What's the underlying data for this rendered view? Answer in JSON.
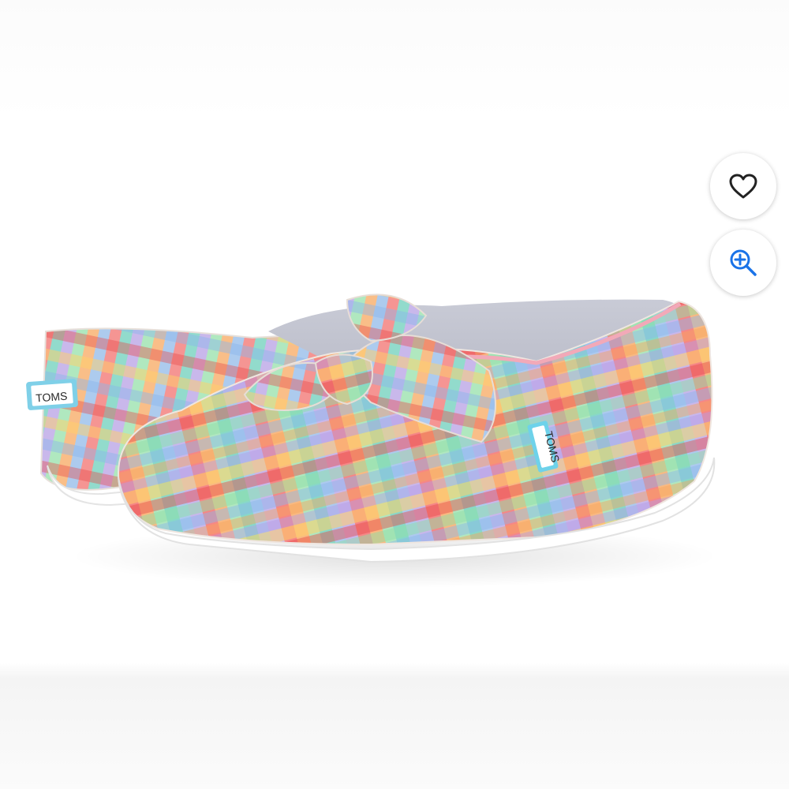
{
  "product": {
    "brand_tags": {
      "heel_tag": "TOMS",
      "side_tag": "TOMS"
    }
  },
  "actions": {
    "like_icon": "heart-outline-icon",
    "zoom_icon": "zoom-in-icon"
  },
  "colors": {
    "accent": "#1a73e8",
    "icon_dark": "#222222",
    "plaid": [
      "#f26a6a",
      "#f7a45a",
      "#ffd06a",
      "#8fe0a8",
      "#49c7b1",
      "#8ab7ec",
      "#b39be8",
      "#e64848"
    ]
  }
}
